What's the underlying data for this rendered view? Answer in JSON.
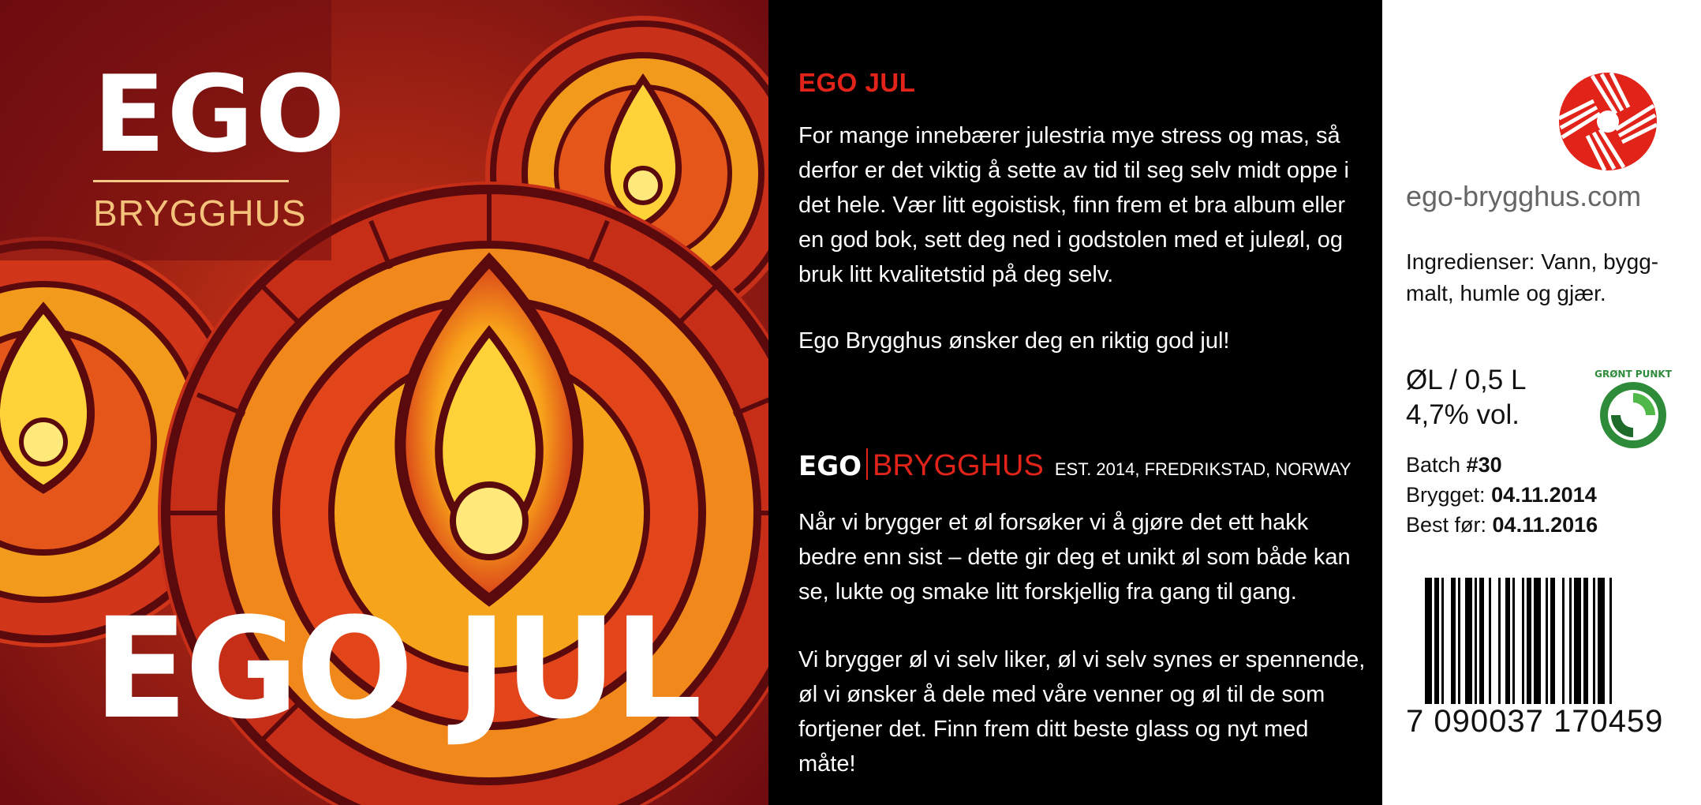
{
  "brand": {
    "ego": "EGO",
    "brygghus": "BRYGGHUS"
  },
  "product_title": "EGO JUL",
  "middle": {
    "heading": "EGO JUL",
    "paragraph_1": "For mange innebærer julestria mye stress og mas, så derfor er det viktig å sette av tid til seg selv midt oppe i det hele. Vær litt egoistisk, finn frem et bra album eller en god bok, sett deg ned i godstolen med et juleøl, og bruk litt kvalitetstid på deg selv.",
    "paragraph_2": "Ego Brygghus ønsker deg en riktig god jul!",
    "brand_ego": "EGO",
    "brand_brygghus": "BRYGGHUS",
    "established": "EST. 2014, FREDRIKSTAD, NORWAY",
    "paragraph_3": "Når vi brygger et øl forsøker vi å gjøre det ett hakk bedre enn sist – dette gir deg et unikt øl som både kan se, lukte og smake litt forskjellig fra gang til gang.",
    "paragraph_4": "Vi brygger øl vi selv liker, øl vi selv synes er spennende, øl vi ønsker å dele med våre venner og øl til de som fortjener det. Finn frem ditt beste glass og nyt med måte!"
  },
  "info": {
    "website": "ego-brygghus.com",
    "ingredients": "Ingredienser: Vann, bygg-malt, humle og gjær.",
    "volume_line_1": "ØL / 0,5 L",
    "volume_line_2": "4,7% vol.",
    "batch_label": "Batch ",
    "batch_value": "#30",
    "brewed_label": "Brygget: ",
    "brewed_value": "04.11.2014",
    "best_before_label": "Best før: ",
    "best_before_value": "04.11.2016",
    "recycle_logo_text": "GRØNT PUNKT",
    "barcode_number": "7 090037 170459"
  },
  "colors": {
    "accent_red": "#e2231a",
    "flame_yellow": "#f8b21a",
    "dark_red": "#7a0f10",
    "recycle_green": "#2e8b3a"
  },
  "icons": [
    "ego-star-logo-icon",
    "gront-punkt-icon",
    "barcode-icon",
    "stained-glass-flame-icon"
  ]
}
